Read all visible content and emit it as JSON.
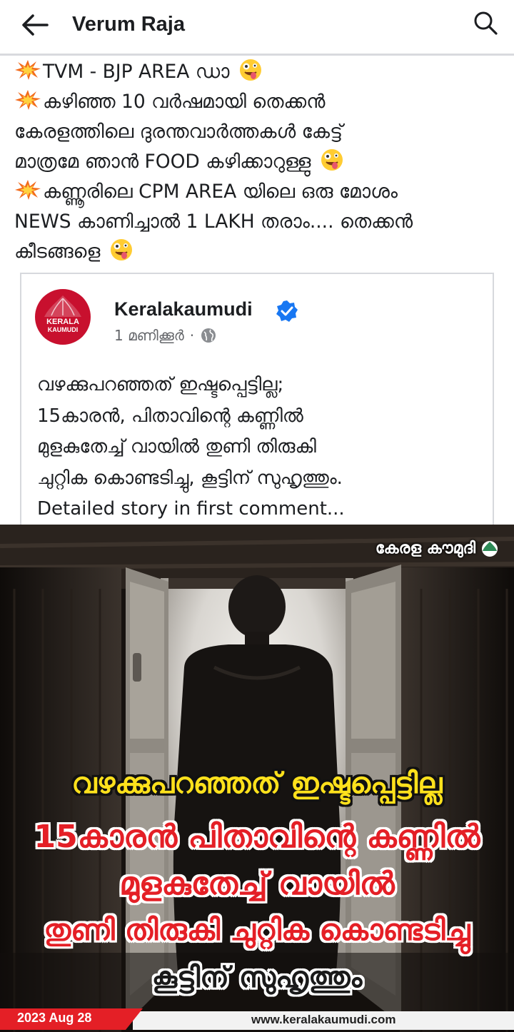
{
  "header": {
    "title": "Verum Raja",
    "back_icon": "back-arrow-icon",
    "search_icon": "search-icon"
  },
  "post": {
    "lines": [
      "TVM - BJP AREA ഡാ",
      "കഴിഞ്ഞ 10 വർഷമായി തെക്കൻ",
      "കേരളത്തിലെ ദുരന്തവാർത്തകൾ കേട്ട്",
      "മാത്രമേ ഞാൻ FOOD കഴിക്കാറുള്ളു",
      "കണ്ണൂരിലെ CPM AREA യിലെ ഒരു മോശം",
      "NEWS കാണിച്ചാൽ 1 LAKH തരാം.... തെക്കൻ",
      "കീടങ്ങളെ"
    ]
  },
  "shared": {
    "page_name": "Keralakaumudi",
    "time": "1 മണിക്കൂർ",
    "separator": "·",
    "logo_text_top": "KERALA",
    "logo_text_bottom": "KAUMUDI",
    "lines": [
      "വഴക്കുപറഞ്ഞത് ഇഷ്ടപ്പെട്ടില്ല;",
      "15കാരൻ, പിതാവിന്റെ കണ്ണിൽ",
      "മുളകുതേച്ച് വായിൽ തുണി തിരുകി",
      "ചുറ്റിക കൊണ്ടടിച്ചു, കൂട്ടിന് സുഹൃത്തും.",
      "Detailed story in first comment..."
    ]
  },
  "image": {
    "watermark": "കേരള കൗമുദി",
    "headline_yellow": "വഴക്കുപറഞ്ഞത് ഇഷ്ടപ്പെട്ടില്ല",
    "headline_red": [
      "15കാരൻ പിതാവിന്റെ കണ്ണിൽ",
      "മുളകുതേച്ച് വായിൽ",
      "തുണി തിരുകി ചുറ്റിക കൊണ്ടടിച്ചു"
    ],
    "headline_black": "കൂട്ടിന് സുഹൃത്തും",
    "date": "2023 Aug 28",
    "website": "www.keralakaumudi.com"
  },
  "colors": {
    "accent_red": "#e41f26",
    "headline_yellow": "#ffe11c",
    "verified_blue": "#1877f2",
    "meta_gray": "#65676b"
  }
}
